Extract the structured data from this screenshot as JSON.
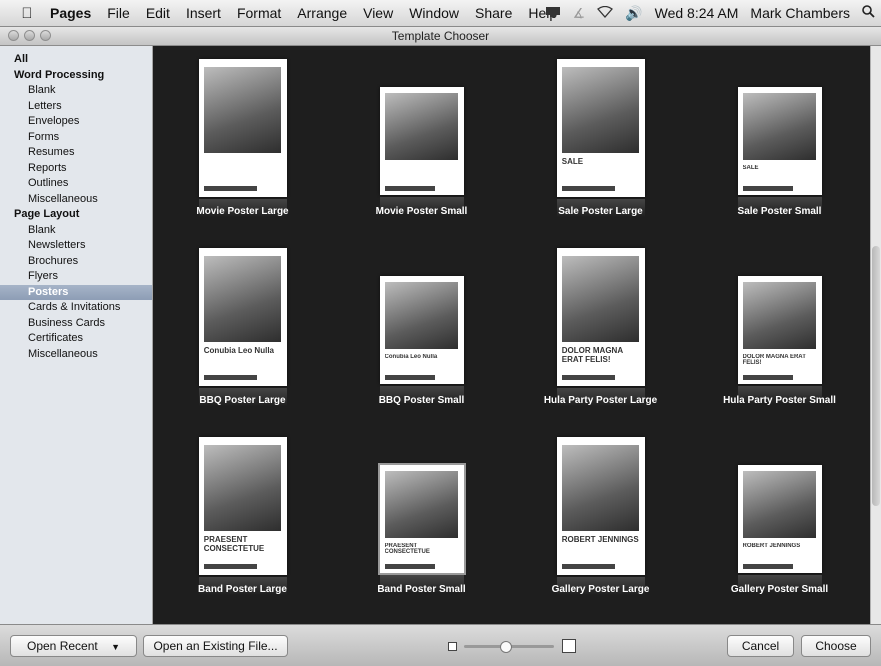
{
  "menubar": {
    "app": "Pages",
    "items": [
      "File",
      "Edit",
      "Insert",
      "Format",
      "Arrange",
      "View",
      "Window",
      "Share",
      "Help"
    ],
    "clock": "Wed 8:24 AM",
    "user": "Mark Chambers"
  },
  "window": {
    "title": "Template Chooser"
  },
  "sidebar": {
    "items": [
      {
        "label": "All",
        "type": "group"
      },
      {
        "label": "Word Processing",
        "type": "group"
      },
      {
        "label": "Blank",
        "type": "item"
      },
      {
        "label": "Letters",
        "type": "item"
      },
      {
        "label": "Envelopes",
        "type": "item"
      },
      {
        "label": "Forms",
        "type": "item"
      },
      {
        "label": "Resumes",
        "type": "item"
      },
      {
        "label": "Reports",
        "type": "item"
      },
      {
        "label": "Outlines",
        "type": "item"
      },
      {
        "label": "Miscellaneous",
        "type": "item"
      },
      {
        "label": "Page Layout",
        "type": "group"
      },
      {
        "label": "Blank",
        "type": "item"
      },
      {
        "label": "Newsletters",
        "type": "item"
      },
      {
        "label": "Brochures",
        "type": "item"
      },
      {
        "label": "Flyers",
        "type": "item"
      },
      {
        "label": "Posters",
        "type": "item",
        "selected": true
      },
      {
        "label": "Cards & Invitations",
        "type": "item"
      },
      {
        "label": "Business Cards",
        "type": "item"
      },
      {
        "label": "Certificates",
        "type": "item"
      },
      {
        "label": "Miscellaneous",
        "type": "item"
      }
    ]
  },
  "templates": [
    {
      "name": "Movie Poster Large",
      "size": "large",
      "headline": ""
    },
    {
      "name": "Movie Poster Small",
      "size": "small",
      "headline": ""
    },
    {
      "name": "Sale Poster Large",
      "size": "large",
      "headline": "SALE"
    },
    {
      "name": "Sale Poster Small",
      "size": "small",
      "headline": "SALE"
    },
    {
      "name": "BBQ Poster Large",
      "size": "large",
      "headline": "Conubia Leo Nulla"
    },
    {
      "name": "BBQ Poster Small",
      "size": "small",
      "headline": "Conubia Leo Nulla"
    },
    {
      "name": "Hula Party Poster Large",
      "size": "large",
      "headline": "DOLOR MAGNA ERAT FELIS!"
    },
    {
      "name": "Hula Party Poster Small",
      "size": "small",
      "headline": "DOLOR MAGNA ERAT FELIS!"
    },
    {
      "name": "Band Poster Large",
      "size": "large",
      "headline": "PRAESENT CONSECTETUE"
    },
    {
      "name": "Band Poster Small",
      "size": "small",
      "headline": "PRAESENT CONSECTETUE",
      "selected": true
    },
    {
      "name": "Gallery Poster Large",
      "size": "large",
      "headline": "ROBERT JENNINGS"
    },
    {
      "name": "Gallery Poster Small",
      "size": "small",
      "headline": "ROBERT JENNINGS"
    }
  ],
  "bottombar": {
    "open_recent": "Open Recent",
    "open_existing": "Open an Existing File...",
    "cancel": "Cancel",
    "choose": "Choose"
  }
}
